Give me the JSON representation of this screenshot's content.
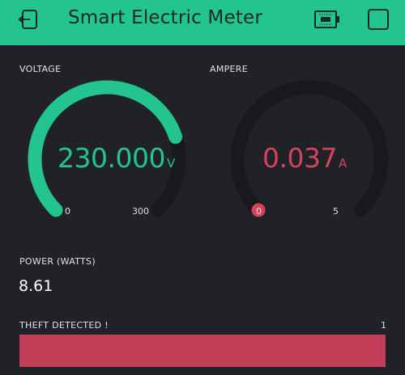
{
  "header": {
    "title": "Smart Electric Meter",
    "back_icon": "exit-icon",
    "device_icon": "device-board-icon",
    "menu_icon": "square-icon",
    "color": "#23c48e"
  },
  "voltage": {
    "label": "VOLTAGE",
    "value_text": "230.000",
    "unit": "V",
    "min_label": "0",
    "max_label": "300",
    "min": 0,
    "max": 300,
    "value": 230,
    "color": "#23c48e"
  },
  "ampere": {
    "label": "AMPERE",
    "value_text": "0.037",
    "unit": "A",
    "min_label": "0",
    "max_label": "5",
    "min": 0,
    "max": 5,
    "value": 0.037,
    "color": "#d3435c"
  },
  "power": {
    "label": "POWER (WATTS)",
    "value": "8.61"
  },
  "theft": {
    "label": "THEFT DETECTED !",
    "value": "1",
    "color": "#c13d58"
  }
}
